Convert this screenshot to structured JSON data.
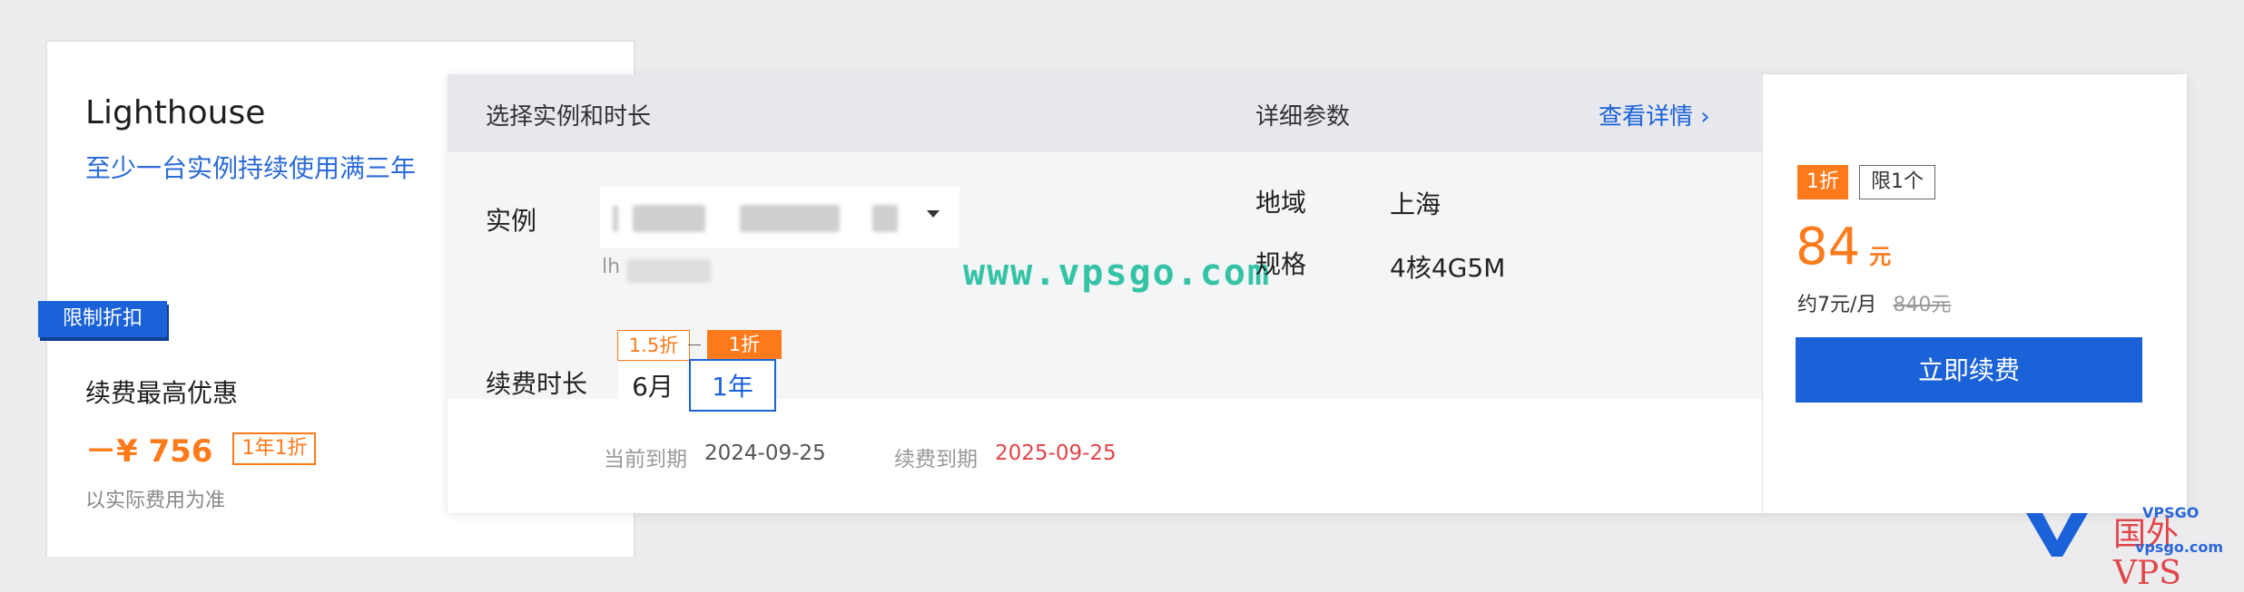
{
  "left_card": {
    "title": "Lighthouse",
    "subtitle": "至少一台实例持续使用满三年",
    "badge": "限制折扣",
    "promo_title": "续费最高优惠",
    "saving_amount": "－¥ 756",
    "saving_tag": "1年1折",
    "note": "以实际费用为准"
  },
  "header": {
    "select_label": "选择实例和时长",
    "params_label": "详细参数",
    "details_link": "查看详情 ›"
  },
  "instance": {
    "label": "实例",
    "id_prefix": "lh"
  },
  "watermark": "www.vpsgo.com",
  "params": {
    "region_key": "地域",
    "region_value": "上海",
    "spec_key": "规格",
    "spec_value": "4核4G5M"
  },
  "duration": {
    "label": "续费时长",
    "options": [
      {
        "label": "6月",
        "discount": "1.5折",
        "selected": false
      },
      {
        "label": "1年",
        "discount": "1折",
        "selected": true
      }
    ]
  },
  "dates": {
    "current_label": "当前到期",
    "current_value": "2024-09-25",
    "renew_label": "续费到期",
    "renew_value": "2025-09-25"
  },
  "price": {
    "discount_badge": "1折",
    "limit_badge": "限1个",
    "amount": "84",
    "unit": "元",
    "monthly": "约7元/月",
    "original": "840元",
    "renew_button": "立即续费"
  },
  "logo": {
    "text_top": "VPSGO",
    "text_main": "国外VPS",
    "text_url": "vpsgo.com"
  },
  "colors": {
    "accent_blue": "#1b62d9",
    "orange": "#ff7a1a",
    "red_date": "#e0454a",
    "watermark": "#35c3a6"
  }
}
